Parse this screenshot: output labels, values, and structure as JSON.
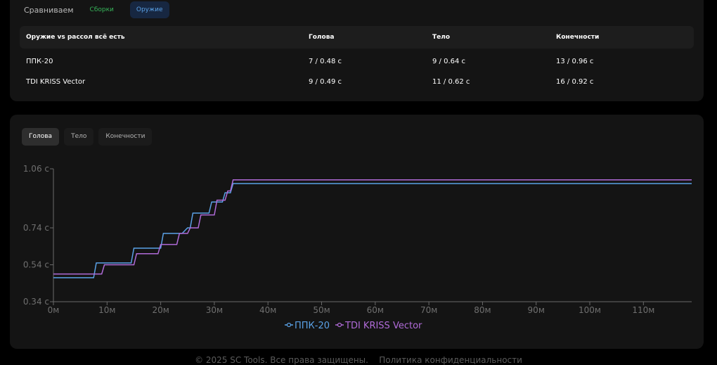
{
  "compare": {
    "label": "Сравниваем",
    "tab_builds": "Сборки",
    "tab_weapons": "Оружие"
  },
  "table": {
    "headers": [
      "Оружие vs рассол всё есть",
      "Голова",
      "Тело",
      "Конечности"
    ],
    "rows": [
      [
        "ППК-20",
        "7 / 0.48 с",
        "9 / 0.64 с",
        "13 / 0.96 с"
      ],
      [
        "TDI KRISS Vector",
        "9 / 0.49 с",
        "11 / 0.62 с",
        "16 / 0.92 с"
      ]
    ]
  },
  "chart_tabs": [
    {
      "label": "Голова",
      "active": true
    },
    {
      "label": "Тело",
      "active": false
    },
    {
      "label": "Конечности",
      "active": false
    }
  ],
  "footer": "© 2025 SC Tools. Все права защищены.    Политика конфиденциальности",
  "chart_data": {
    "type": "line",
    "x_ticks": [
      "0м",
      "10м",
      "20м",
      "30м",
      "40м",
      "50м",
      "60м",
      "70м",
      "80м",
      "90м",
      "100м",
      "110м"
    ],
    "y_ticks": [
      "1.06 с",
      "0.74 с",
      "0.54 с",
      "0.34 с"
    ],
    "xlim": [
      0,
      119
    ],
    "ylim": [
      0.34,
      1.06
    ],
    "series": [
      {
        "name": "ППК-20",
        "color": "#5aa1e6",
        "x": [
          0,
          7.5,
          8,
          14.5,
          15,
          20,
          20.5,
          24,
          25,
          25.5,
          26,
          29,
          29.5,
          31.5,
          32,
          33,
          33.5,
          119
        ],
        "y": [
          0.47,
          0.47,
          0.55,
          0.55,
          0.63,
          0.63,
          0.71,
          0.71,
          0.74,
          0.74,
          0.82,
          0.82,
          0.88,
          0.88,
          0.93,
          0.93,
          0.98,
          0.98
        ]
      },
      {
        "name": "TDI KRISS Vector",
        "color": "#b06bd8",
        "x": [
          0,
          9,
          9.5,
          15,
          15.5,
          19.5,
          20,
          23,
          23.5,
          25,
          25.5,
          27,
          27.5,
          30,
          30.5,
          32,
          32.5,
          33,
          33.5,
          119
        ],
        "y": [
          0.49,
          0.49,
          0.54,
          0.54,
          0.6,
          0.6,
          0.65,
          0.65,
          0.71,
          0.71,
          0.74,
          0.74,
          0.81,
          0.81,
          0.89,
          0.89,
          0.94,
          0.94,
          1.0,
          1.0
        ]
      }
    ]
  }
}
